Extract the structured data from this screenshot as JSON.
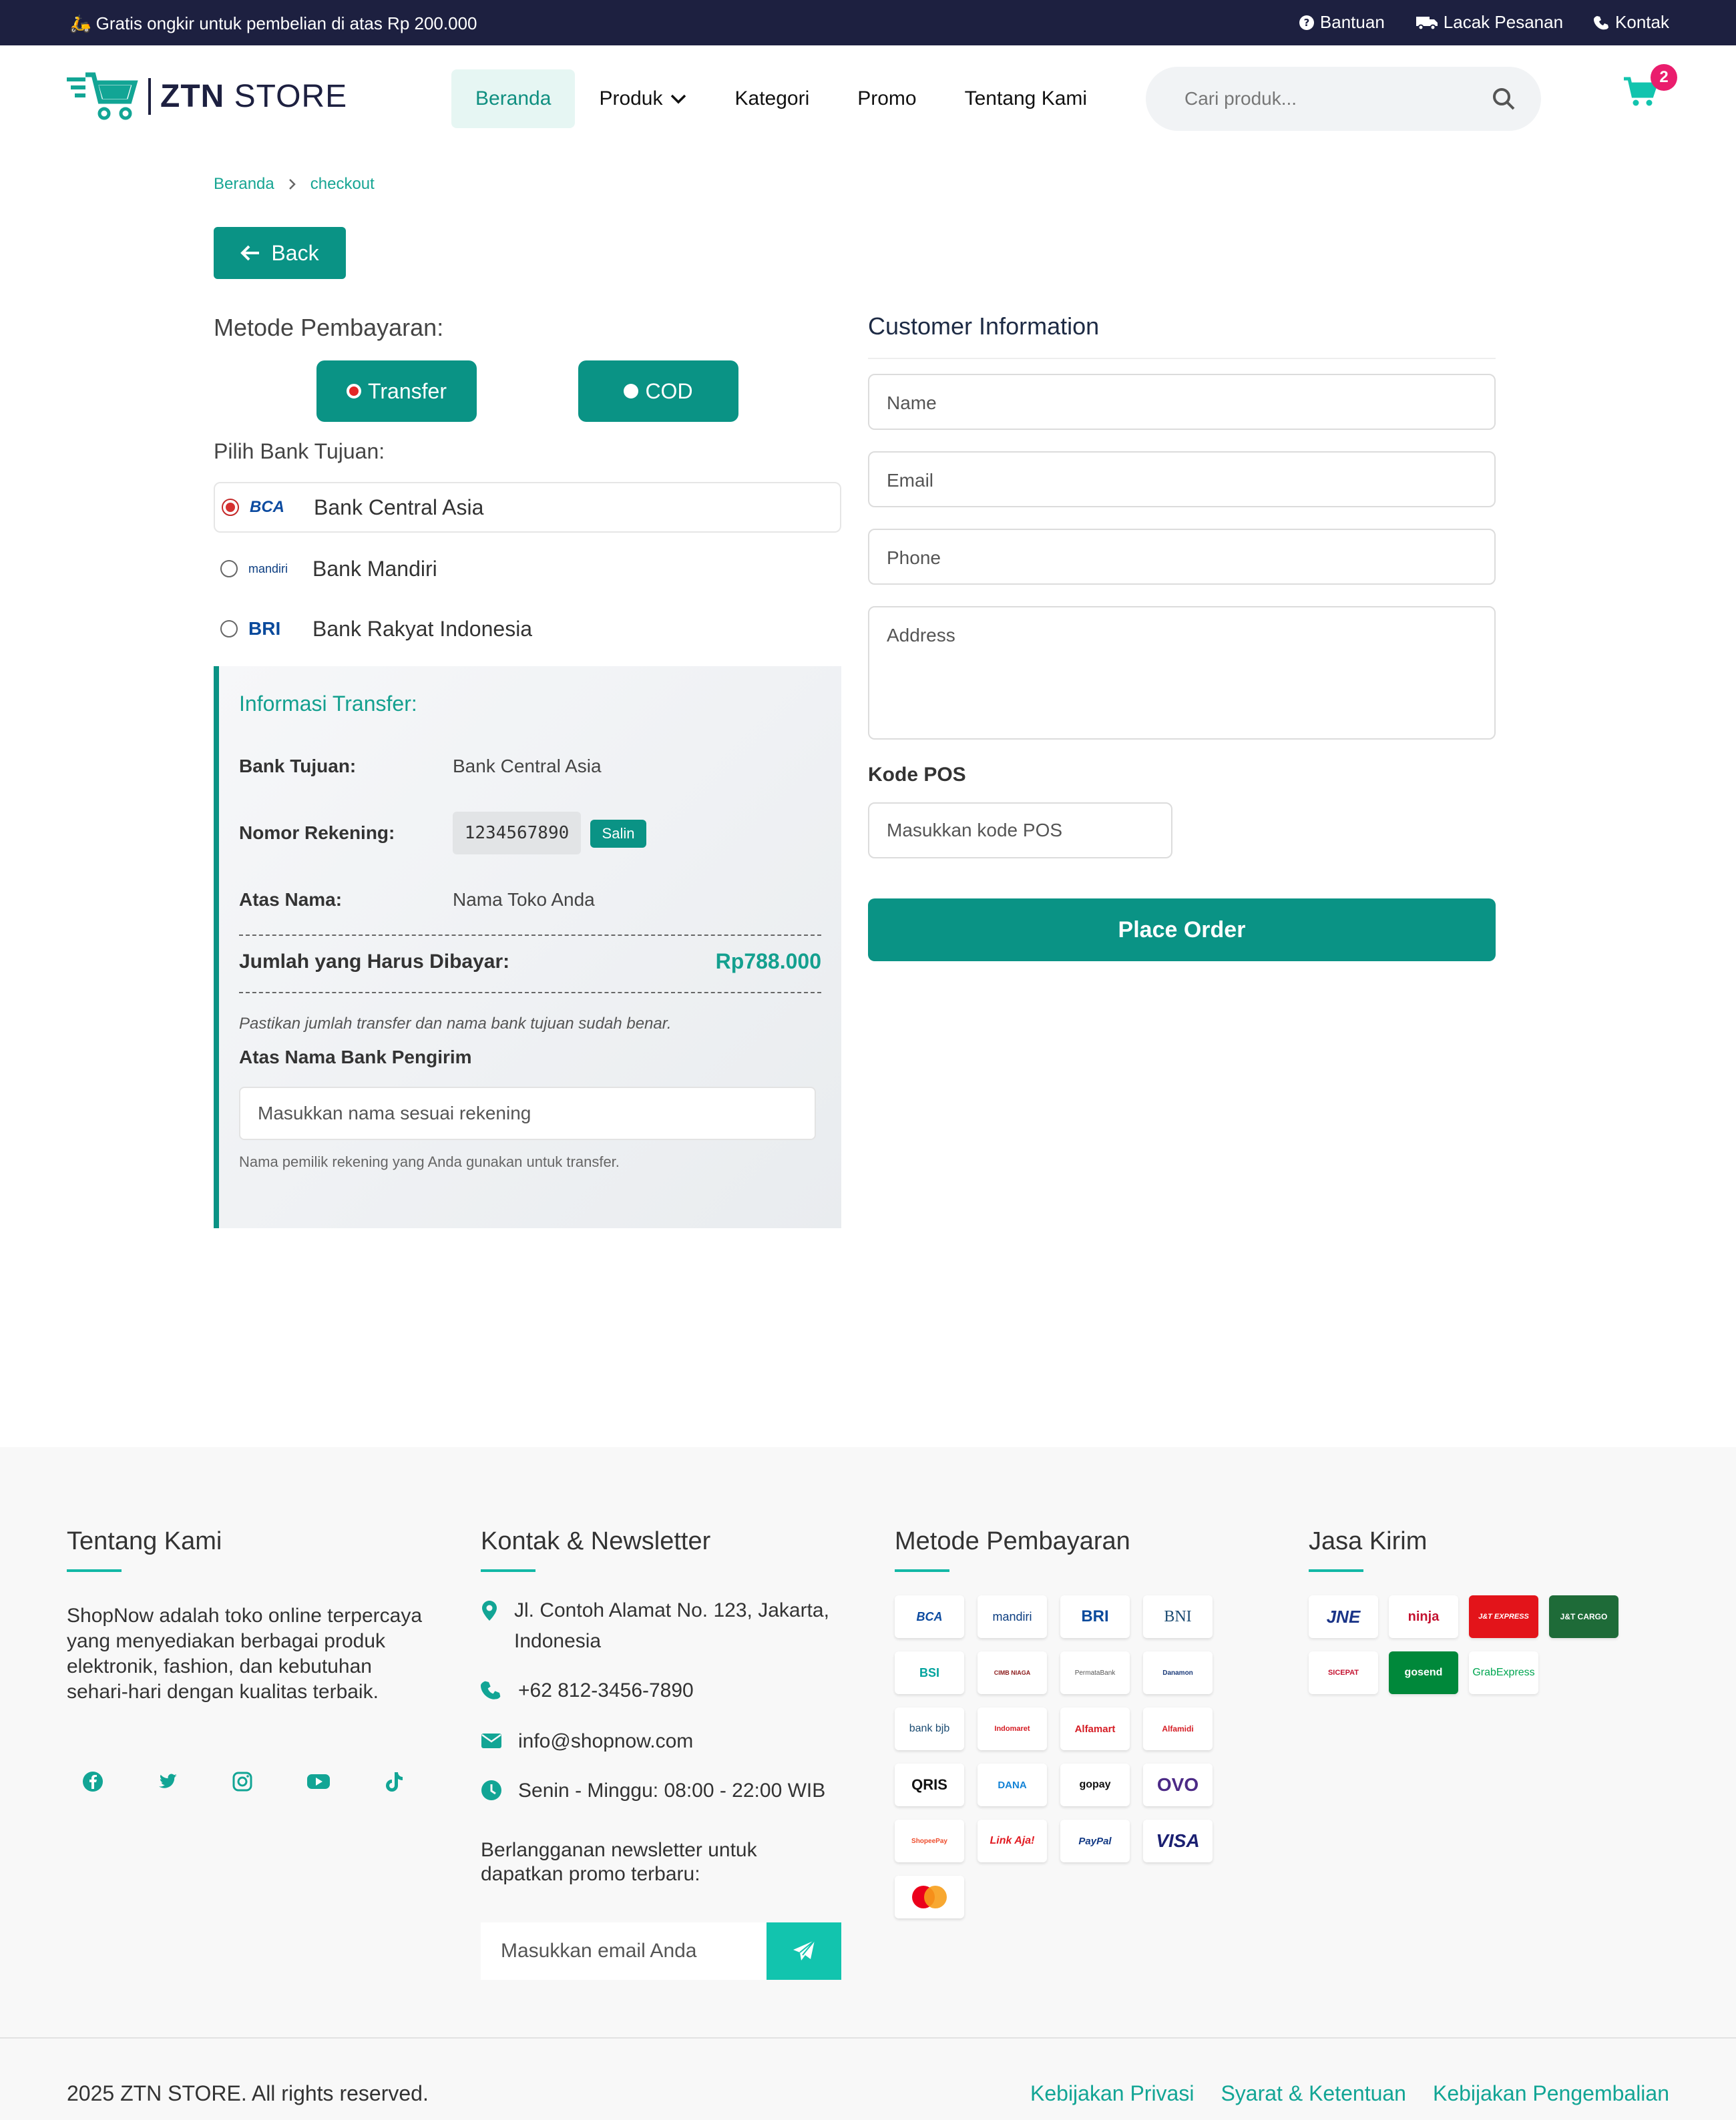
{
  "topbar": {
    "promo": "🛵 Gratis ongkir untuk pembelian di atas Rp 200.000",
    "links": [
      "Bantuan",
      "Lacak Pesanan",
      "Kontak"
    ]
  },
  "header": {
    "logo_bold": "ZTN",
    "logo_light": " STORE",
    "nav": [
      "Beranda",
      "Produk",
      "Kategori",
      "Promo",
      "Tentang Kami"
    ],
    "search_placeholder": "Cari produk...",
    "cart_count": "2"
  },
  "breadcrumb": [
    "Beranda",
    "checkout"
  ],
  "back_label": "Back",
  "payment": {
    "heading": "Metode Pembayaran:",
    "methods": [
      "Transfer",
      "COD"
    ],
    "bank_heading": "Pilih Bank Tujuan:",
    "banks": [
      {
        "logo": "BCA",
        "name": "Bank Central Asia"
      },
      {
        "logo": "mandiri",
        "name": "Bank Mandiri"
      },
      {
        "logo": "BRI",
        "name": "Bank Rakyat Indonesia"
      }
    ]
  },
  "transfer": {
    "title": "Informasi Transfer:",
    "bank_label": "Bank Tujuan:",
    "bank_value": "Bank Central Asia",
    "account_label": "Nomor Rekening:",
    "account_value": "1234567890",
    "copy_label": "Salin",
    "holder_label": "Atas Nama:",
    "holder_value": "Nama Toko Anda",
    "total_label": "Jumlah yang Harus Dibayar:",
    "total_value": "Rp788.000",
    "note": "Pastikan jumlah transfer dan nama bank tujuan sudah benar.",
    "sender_label": "Atas Nama Bank Pengirim",
    "sender_placeholder": "Masukkan nama sesuai rekening",
    "sender_help": "Nama pemilik rekening yang Anda gunakan untuk transfer."
  },
  "customer": {
    "heading": "Customer Information",
    "name_placeholder": "Name",
    "email_placeholder": "Email",
    "phone_placeholder": "Phone",
    "address_placeholder": "Address",
    "pos_label": "Kode POS",
    "pos_placeholder": "Masukkan kode POS",
    "order_label": "Place Order"
  },
  "footer": {
    "about_title": "Tentang Kami",
    "about_text": "ShopNow adalah toko online terpercaya yang menyediakan berbagai produk elektronik, fashion, dan kebutuhan sehari-hari dengan kualitas terbaik.",
    "contact_title": "Kontak & Newsletter",
    "address": "Jl. Contoh Alamat No. 123, Jakarta, Indonesia",
    "phone": "+62 812-3456-7890",
    "email": "info@shopnow.com",
    "hours": "Senin - Minggu: 08:00 - 22:00 WIB",
    "newsletter_text": "Berlangganan newsletter untuk dapatkan promo terbaru:",
    "newsletter_placeholder": "Masukkan email Anda",
    "payment_title": "Metode Pembayaran",
    "payment_logos": [
      "BCA",
      "mandiri",
      "BRI",
      "BNI",
      "BSI",
      "CIMB NIAGA",
      "PermataBank",
      "Danamon",
      "bank bjb",
      "Indomaret",
      "Alfamart",
      "Alfamidi",
      "QRIS",
      "DANA",
      "gopay",
      "OVO",
      "ShopeePay",
      "Link Aja!",
      "PayPal",
      "VISA",
      "mastercard"
    ],
    "shipping_title": "Jasa Kirim",
    "shipping_logos": [
      "JNE",
      "ninja",
      "J&T EXPRESS",
      "J&T CARGO",
      "SICEPAT",
      "gosend",
      "GrabExpress"
    ],
    "copyright": "2025 ZTN STORE. All rights reserved.",
    "legal": [
      "Kebijakan Privasi",
      "Syarat & Ketentuan",
      "Kebijakan Pengembalian"
    ]
  },
  "colors": {
    "primary": "#0a9385",
    "accent": "#12c4ae",
    "topbar": "#1d2040",
    "badge": "#ea1d6d"
  }
}
